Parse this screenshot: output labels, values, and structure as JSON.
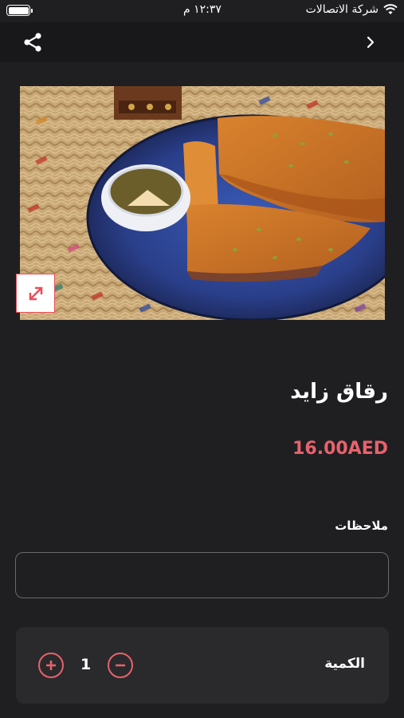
{
  "status_bar": {
    "carrier": "شركة الاتصالات",
    "time": "١٢:٣٧ م",
    "battery_level": 1.0
  },
  "nav": {
    "share_icon": "share-icon",
    "forward_icon": "chevron-right-icon"
  },
  "product": {
    "image_icon": "product-photo",
    "expand_icon": "expand-icon",
    "name": "رقاق زايد",
    "price": "16.00AED"
  },
  "notes": {
    "label": "ملاحظات",
    "value": "",
    "placeholder": ""
  },
  "quantity": {
    "label": "الكمية",
    "value": "1",
    "plus_icon": "plus-circle-icon",
    "minus_icon": "minus-circle-icon"
  },
  "colors": {
    "background": "#1f1f22",
    "nav_background": "#18181a",
    "accent": "#e8626b",
    "card": "#2a2a2d"
  }
}
